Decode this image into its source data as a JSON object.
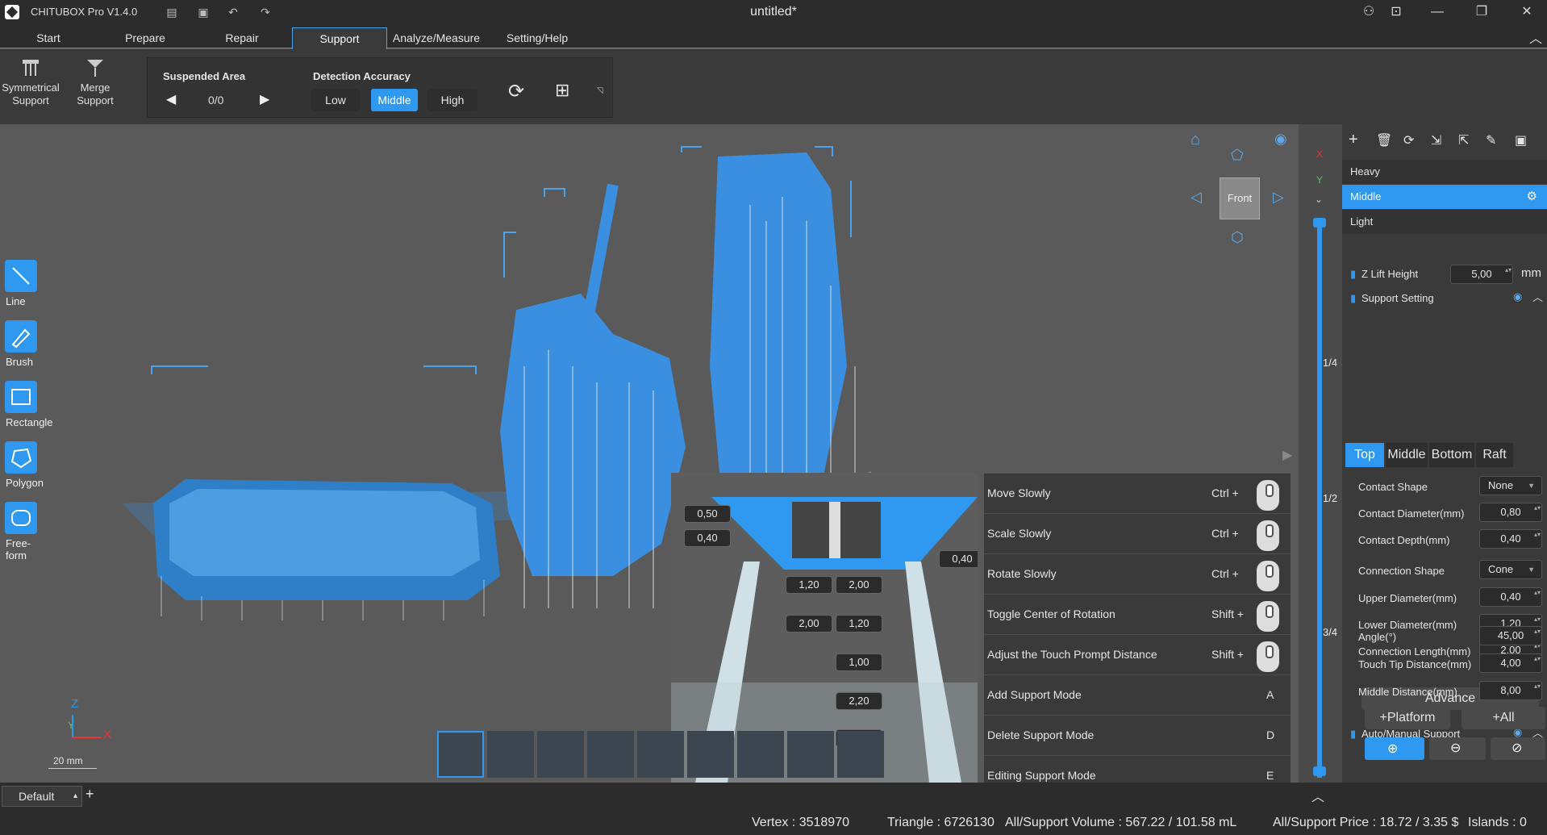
{
  "app": {
    "name": "CHITUBOX Pro V1.4.0",
    "doc_title": "untitled*"
  },
  "menu": {
    "tabs": [
      "Start",
      "Prepare",
      "Repair",
      "Support",
      "Analyze/Measure",
      "Setting/Help"
    ],
    "active": "Support"
  },
  "toolbar": {
    "symmetrical": "Symmetrical\nSupport",
    "merge": "Merge\nSupport",
    "suspended_area": {
      "title": "Suspended Area",
      "value": "0/0"
    },
    "detection": {
      "title": "Detection Accuracy",
      "options": [
        "Low",
        "Middle",
        "High"
      ],
      "active": "Middle"
    }
  },
  "left_tools": [
    {
      "label": "Line",
      "icon": "line-icon"
    },
    {
      "label": "Brush",
      "icon": "brush-icon"
    },
    {
      "label": "Rectangle",
      "icon": "rectangle-icon"
    },
    {
      "label": "Polygon",
      "icon": "polygon-icon"
    },
    {
      "label": "Free-form",
      "icon": "freeform-icon"
    }
  ],
  "axes": {
    "z": "Z",
    "y": "Y",
    "x": "X",
    "scale": "20 mm"
  },
  "view_cube": {
    "face": "Front"
  },
  "axis_column": {
    "x": "X",
    "y": "Y",
    "marks": [
      "1/4",
      "1/2",
      "3/4"
    ]
  },
  "right_panel": {
    "presets": [
      "Heavy",
      "Middle",
      "Light"
    ],
    "active_preset": "Middle",
    "z_lift": {
      "label": "Z Lift Height",
      "value": "5,00",
      "unit": "mm"
    },
    "support_setting": "Support Setting",
    "tabs": [
      "Top",
      "Middle",
      "Bottom",
      "Raft"
    ],
    "active_tab": "Top",
    "fields": [
      {
        "label": "Contact Shape",
        "value": "None",
        "type": "drop"
      },
      {
        "label": "Contact Diameter(mm)",
        "value": "0,80",
        "type": "num"
      },
      {
        "label": "Contact Depth(mm)",
        "value": "0,40",
        "type": "num"
      },
      {
        "label": "Connection Shape",
        "value": "Cone",
        "type": "drop"
      },
      {
        "label": "Upper Diameter(mm)",
        "value": "0,40",
        "type": "num"
      },
      {
        "label": "Lower Diameter(mm)",
        "value": "1,20",
        "type": "num"
      },
      {
        "label": "Connection Length(mm)",
        "value": "2,00",
        "type": "num"
      }
    ],
    "advance": "Advance",
    "auto_manual": "Auto/Manual Support",
    "auto_fields": [
      {
        "label": "Angle(°)",
        "value": "45,00"
      },
      {
        "label": "Touch Tip Distance(mm)",
        "value": "4,00"
      },
      {
        "label": "Middle Distance(mm)",
        "value": "8,00"
      }
    ],
    "platform_btn": "+Platform",
    "all_btn": "+All",
    "remove_all": "Remove All"
  },
  "shortcuts": [
    {
      "name": "Move Slowly",
      "key": "Ctrl +",
      "mouse": true
    },
    {
      "name": "Scale Slowly",
      "key": "Ctrl +",
      "mouse": true
    },
    {
      "name": "Rotate Slowly",
      "key": "Ctrl +",
      "mouse": true
    },
    {
      "name": "Toggle Center of Rotation",
      "key": "Shift +",
      "mouse": true
    },
    {
      "name": "Adjust the Touch Prompt Distance",
      "key": "Shift +",
      "mouse": true
    },
    {
      "name": "Add Support Mode",
      "key": "A",
      "mouse": false
    },
    {
      "name": "Delete Support Mode",
      "key": "D",
      "mouse": false
    },
    {
      "name": "Editing Support Mode",
      "key": "E",
      "mouse": false
    }
  ],
  "preview_values": [
    "0,50",
    "0,40",
    "0,40",
    "1,20",
    "2,00",
    "2,00",
    "1,20",
    "1,00",
    "2,20",
    "0"
  ],
  "bottom": {
    "profile": "Default",
    "add": "+"
  },
  "status": {
    "vertex": "Vertex : 3518970",
    "triangle": "Triangle : 6726130",
    "volume": "All/Support Volume : 567.22 / 101.58 mL",
    "price": "All/Support Price : 18.72 / 3.35 $",
    "islands": "Islands : 0"
  }
}
